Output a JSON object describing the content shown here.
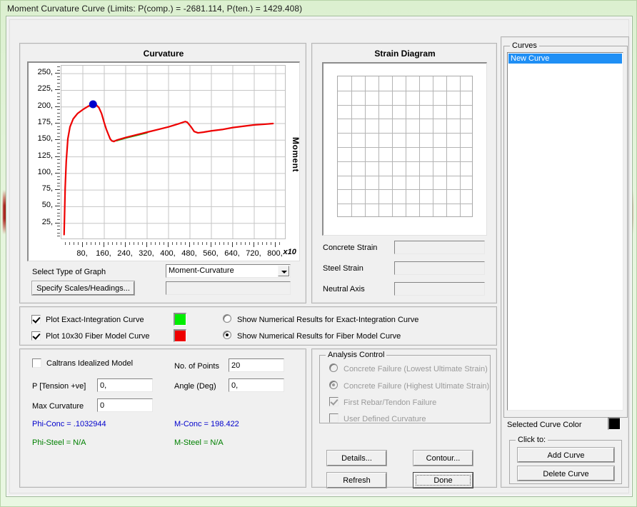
{
  "window": {
    "title": "Moment Curvature Curve (Limits:  P(comp.) = -2681.114, P(ten.) = 1429.408)"
  },
  "chart_panel": {
    "title": "Curvature",
    "yaxis_title": "Moment",
    "x_multiplier": "x10"
  },
  "chart_data": {
    "type": "line",
    "title": "Curvature",
    "xlabel": "",
    "ylabel": "Moment",
    "x_multiplier": "x10",
    "xlim": [
      0,
      840
    ],
    "ylim": [
      0,
      262
    ],
    "grid": true,
    "xticks": [
      80,
      160,
      240,
      320,
      400,
      480,
      560,
      640,
      720,
      800
    ],
    "xtick_labels": [
      "80,",
      "160,",
      "240,",
      "320,",
      "400,",
      "480,",
      "560,",
      "640,",
      "720,",
      "800,"
    ],
    "yticks": [
      25,
      50,
      75,
      100,
      125,
      150,
      175,
      200,
      225,
      250
    ],
    "ytick_labels": [
      "25,",
      "50,",
      "75,",
      "100,",
      "125,",
      "150,",
      "175,",
      "200,",
      "225,",
      "250,"
    ],
    "legend": [
      {
        "name": "Exact-Integration Curve",
        "color": "#00ee00"
      },
      {
        "name": "Fiber Model Curve",
        "color": "#ee0000"
      }
    ],
    "series": [
      {
        "name": "Fiber Model Curve",
        "color": "#ee0000",
        "x": [
          10,
          12,
          14,
          18,
          24,
          32,
          44,
          60,
          80,
          100,
          118,
          130,
          140,
          150,
          160,
          168,
          176,
          182,
          188,
          196,
          206,
          240,
          280,
          320,
          360,
          400,
          440,
          462,
          470,
          484,
          496,
          510,
          530,
          560,
          600,
          640,
          680,
          720,
          760,
          790
        ],
        "y": [
          8,
          42,
          78,
          118,
          152,
          170,
          182,
          190,
          196,
          201,
          204,
          203,
          199,
          190,
          176,
          166,
          158,
          152,
          149,
          148,
          150,
          154,
          158,
          162,
          166,
          170,
          175,
          178,
          177,
          170,
          163,
          161,
          162,
          164,
          166,
          169,
          171,
          173,
          174,
          175
        ]
      },
      {
        "name": "Exact-Integration Curve",
        "color": "#00b000",
        "x": [
          206,
          240,
          280,
          320
        ],
        "y": [
          149,
          153,
          157,
          161
        ]
      }
    ],
    "markers": [
      {
        "x": 118,
        "y": 204,
        "color": "#0000cc",
        "shape": "circle",
        "label": "peak"
      }
    ]
  },
  "graph_controls": {
    "select_type_label": "Select Type of Graph",
    "graph_type_value": "Moment-Curvature",
    "specify_scales_button": "Specify Scales/Headings...",
    "side_field_value": ""
  },
  "strain_panel": {
    "title": "Strain Diagram",
    "fields": [
      {
        "label": "Concrete Strain",
        "value": ""
      },
      {
        "label": "Steel Strain",
        "value": ""
      },
      {
        "label": "Neutral Axis",
        "value": ""
      }
    ]
  },
  "plot_options": {
    "checkboxes": [
      {
        "label": "Plot Exact-Integration Curve",
        "checked": true,
        "color": "#00ee00"
      },
      {
        "label": "Plot 10x30 Fiber Model Curve",
        "checked": true,
        "color": "#ee0000"
      }
    ],
    "radios": [
      {
        "label": "Show Numerical Results for Exact-Integration Curve",
        "selected": false
      },
      {
        "label": "Show Numerical Results for Fiber Model Curve",
        "selected": true
      }
    ]
  },
  "parameters": {
    "caltrans_label": "Caltrans Idealized Model",
    "caltrans_checked": false,
    "p_tension_label": "P [Tension +ve]",
    "p_tension_value": "0,",
    "max_curvature_label": "Max Curvature",
    "max_curvature_value": "0",
    "no_of_points_label": "No. of Points",
    "no_of_points_value": "20",
    "angle_label": "Angle (Deg)",
    "angle_value": "0,",
    "results": [
      {
        "text": "Phi-Conc = .1032944",
        "color": "#0000cc"
      },
      {
        "text": "M-Conc = 198.422",
        "color": "#0000cc"
      },
      {
        "text": "Phi-Steel = N/A",
        "color": "#008000"
      },
      {
        "text": "M-Steel = N/A",
        "color": "#008000"
      }
    ]
  },
  "analysis_control": {
    "legend": "Analysis Control",
    "items": [
      {
        "type": "radio",
        "label": "Concrete Failure (Lowest Ultimate Strain)",
        "selected": false,
        "disabled": true
      },
      {
        "type": "radio",
        "label": "Concrete Failure (Highest Ultimate Strain)",
        "selected": true,
        "disabled": true
      },
      {
        "type": "checkbox",
        "label": "First Rebar/Tendon Failure",
        "checked": true,
        "disabled": true
      },
      {
        "type": "checkbox",
        "label": "User Defined Curvature",
        "checked": false,
        "disabled": true
      }
    ]
  },
  "action_buttons": {
    "details": "Details...",
    "contour": "Contour...",
    "refresh": "Refresh",
    "done": "Done"
  },
  "curves_panel": {
    "legend": "Curves",
    "items": [
      {
        "label": "New Curve",
        "selected": true
      }
    ],
    "selected_color_label": "Selected Curve Color",
    "selected_color": "#000000",
    "clickto_legend": "Click to:",
    "add_button": "Add Curve",
    "delete_button": "Delete Curve"
  }
}
